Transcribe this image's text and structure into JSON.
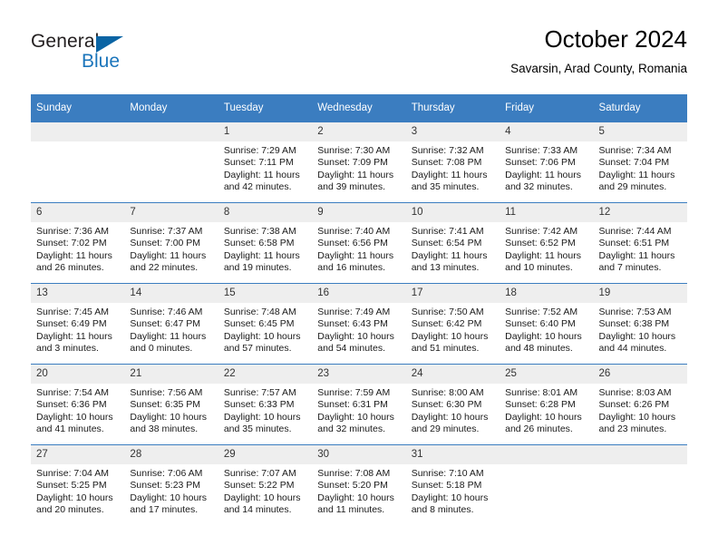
{
  "brand": {
    "name_part1": "General",
    "name_part2": "Blue",
    "accent_color": "#1b75bb",
    "triangle_color": "#0a64a4",
    "triangle_icon": "triangle-icon"
  },
  "header": {
    "month_title": "October 2024",
    "location": "Savarsin, Arad County, Romania"
  },
  "calendar": {
    "header_bg": "#3b7dc0",
    "daynum_bg": "#eeeeee",
    "weekdays": [
      "Sunday",
      "Monday",
      "Tuesday",
      "Wednesday",
      "Thursday",
      "Friday",
      "Saturday"
    ],
    "weeks": [
      [
        {
          "day": "",
          "empty": true
        },
        {
          "day": "",
          "empty": true
        },
        {
          "day": "1",
          "sunrise": "Sunrise: 7:29 AM",
          "sunset": "Sunset: 7:11 PM",
          "daylight_line1": "Daylight: 11 hours",
          "daylight_line2": "and 42 minutes."
        },
        {
          "day": "2",
          "sunrise": "Sunrise: 7:30 AM",
          "sunset": "Sunset: 7:09 PM",
          "daylight_line1": "Daylight: 11 hours",
          "daylight_line2": "and 39 minutes."
        },
        {
          "day": "3",
          "sunrise": "Sunrise: 7:32 AM",
          "sunset": "Sunset: 7:08 PM",
          "daylight_line1": "Daylight: 11 hours",
          "daylight_line2": "and 35 minutes."
        },
        {
          "day": "4",
          "sunrise": "Sunrise: 7:33 AM",
          "sunset": "Sunset: 7:06 PM",
          "daylight_line1": "Daylight: 11 hours",
          "daylight_line2": "and 32 minutes."
        },
        {
          "day": "5",
          "sunrise": "Sunrise: 7:34 AM",
          "sunset": "Sunset: 7:04 PM",
          "daylight_line1": "Daylight: 11 hours",
          "daylight_line2": "and 29 minutes."
        }
      ],
      [
        {
          "day": "6",
          "sunrise": "Sunrise: 7:36 AM",
          "sunset": "Sunset: 7:02 PM",
          "daylight_line1": "Daylight: 11 hours",
          "daylight_line2": "and 26 minutes."
        },
        {
          "day": "7",
          "sunrise": "Sunrise: 7:37 AM",
          "sunset": "Sunset: 7:00 PM",
          "daylight_line1": "Daylight: 11 hours",
          "daylight_line2": "and 22 minutes."
        },
        {
          "day": "8",
          "sunrise": "Sunrise: 7:38 AM",
          "sunset": "Sunset: 6:58 PM",
          "daylight_line1": "Daylight: 11 hours",
          "daylight_line2": "and 19 minutes."
        },
        {
          "day": "9",
          "sunrise": "Sunrise: 7:40 AM",
          "sunset": "Sunset: 6:56 PM",
          "daylight_line1": "Daylight: 11 hours",
          "daylight_line2": "and 16 minutes."
        },
        {
          "day": "10",
          "sunrise": "Sunrise: 7:41 AM",
          "sunset": "Sunset: 6:54 PM",
          "daylight_line1": "Daylight: 11 hours",
          "daylight_line2": "and 13 minutes."
        },
        {
          "day": "11",
          "sunrise": "Sunrise: 7:42 AM",
          "sunset": "Sunset: 6:52 PM",
          "daylight_line1": "Daylight: 11 hours",
          "daylight_line2": "and 10 minutes."
        },
        {
          "day": "12",
          "sunrise": "Sunrise: 7:44 AM",
          "sunset": "Sunset: 6:51 PM",
          "daylight_line1": "Daylight: 11 hours",
          "daylight_line2": "and 7 minutes."
        }
      ],
      [
        {
          "day": "13",
          "sunrise": "Sunrise: 7:45 AM",
          "sunset": "Sunset: 6:49 PM",
          "daylight_line1": "Daylight: 11 hours",
          "daylight_line2": "and 3 minutes."
        },
        {
          "day": "14",
          "sunrise": "Sunrise: 7:46 AM",
          "sunset": "Sunset: 6:47 PM",
          "daylight_line1": "Daylight: 11 hours",
          "daylight_line2": "and 0 minutes."
        },
        {
          "day": "15",
          "sunrise": "Sunrise: 7:48 AM",
          "sunset": "Sunset: 6:45 PM",
          "daylight_line1": "Daylight: 10 hours",
          "daylight_line2": "and 57 minutes."
        },
        {
          "day": "16",
          "sunrise": "Sunrise: 7:49 AM",
          "sunset": "Sunset: 6:43 PM",
          "daylight_line1": "Daylight: 10 hours",
          "daylight_line2": "and 54 minutes."
        },
        {
          "day": "17",
          "sunrise": "Sunrise: 7:50 AM",
          "sunset": "Sunset: 6:42 PM",
          "daylight_line1": "Daylight: 10 hours",
          "daylight_line2": "and 51 minutes."
        },
        {
          "day": "18",
          "sunrise": "Sunrise: 7:52 AM",
          "sunset": "Sunset: 6:40 PM",
          "daylight_line1": "Daylight: 10 hours",
          "daylight_line2": "and 48 minutes."
        },
        {
          "day": "19",
          "sunrise": "Sunrise: 7:53 AM",
          "sunset": "Sunset: 6:38 PM",
          "daylight_line1": "Daylight: 10 hours",
          "daylight_line2": "and 44 minutes."
        }
      ],
      [
        {
          "day": "20",
          "sunrise": "Sunrise: 7:54 AM",
          "sunset": "Sunset: 6:36 PM",
          "daylight_line1": "Daylight: 10 hours",
          "daylight_line2": "and 41 minutes."
        },
        {
          "day": "21",
          "sunrise": "Sunrise: 7:56 AM",
          "sunset": "Sunset: 6:35 PM",
          "daylight_line1": "Daylight: 10 hours",
          "daylight_line2": "and 38 minutes."
        },
        {
          "day": "22",
          "sunrise": "Sunrise: 7:57 AM",
          "sunset": "Sunset: 6:33 PM",
          "daylight_line1": "Daylight: 10 hours",
          "daylight_line2": "and 35 minutes."
        },
        {
          "day": "23",
          "sunrise": "Sunrise: 7:59 AM",
          "sunset": "Sunset: 6:31 PM",
          "daylight_line1": "Daylight: 10 hours",
          "daylight_line2": "and 32 minutes."
        },
        {
          "day": "24",
          "sunrise": "Sunrise: 8:00 AM",
          "sunset": "Sunset: 6:30 PM",
          "daylight_line1": "Daylight: 10 hours",
          "daylight_line2": "and 29 minutes."
        },
        {
          "day": "25",
          "sunrise": "Sunrise: 8:01 AM",
          "sunset": "Sunset: 6:28 PM",
          "daylight_line1": "Daylight: 10 hours",
          "daylight_line2": "and 26 minutes."
        },
        {
          "day": "26",
          "sunrise": "Sunrise: 8:03 AM",
          "sunset": "Sunset: 6:26 PM",
          "daylight_line1": "Daylight: 10 hours",
          "daylight_line2": "and 23 minutes."
        }
      ],
      [
        {
          "day": "27",
          "sunrise": "Sunrise: 7:04 AM",
          "sunset": "Sunset: 5:25 PM",
          "daylight_line1": "Daylight: 10 hours",
          "daylight_line2": "and 20 minutes."
        },
        {
          "day": "28",
          "sunrise": "Sunrise: 7:06 AM",
          "sunset": "Sunset: 5:23 PM",
          "daylight_line1": "Daylight: 10 hours",
          "daylight_line2": "and 17 minutes."
        },
        {
          "day": "29",
          "sunrise": "Sunrise: 7:07 AM",
          "sunset": "Sunset: 5:22 PM",
          "daylight_line1": "Daylight: 10 hours",
          "daylight_line2": "and 14 minutes."
        },
        {
          "day": "30",
          "sunrise": "Sunrise: 7:08 AM",
          "sunset": "Sunset: 5:20 PM",
          "daylight_line1": "Daylight: 10 hours",
          "daylight_line2": "and 11 minutes."
        },
        {
          "day": "31",
          "sunrise": "Sunrise: 7:10 AM",
          "sunset": "Sunset: 5:18 PM",
          "daylight_line1": "Daylight: 10 hours",
          "daylight_line2": "and 8 minutes."
        },
        {
          "day": "",
          "empty": true
        },
        {
          "day": "",
          "empty": true
        }
      ]
    ]
  }
}
